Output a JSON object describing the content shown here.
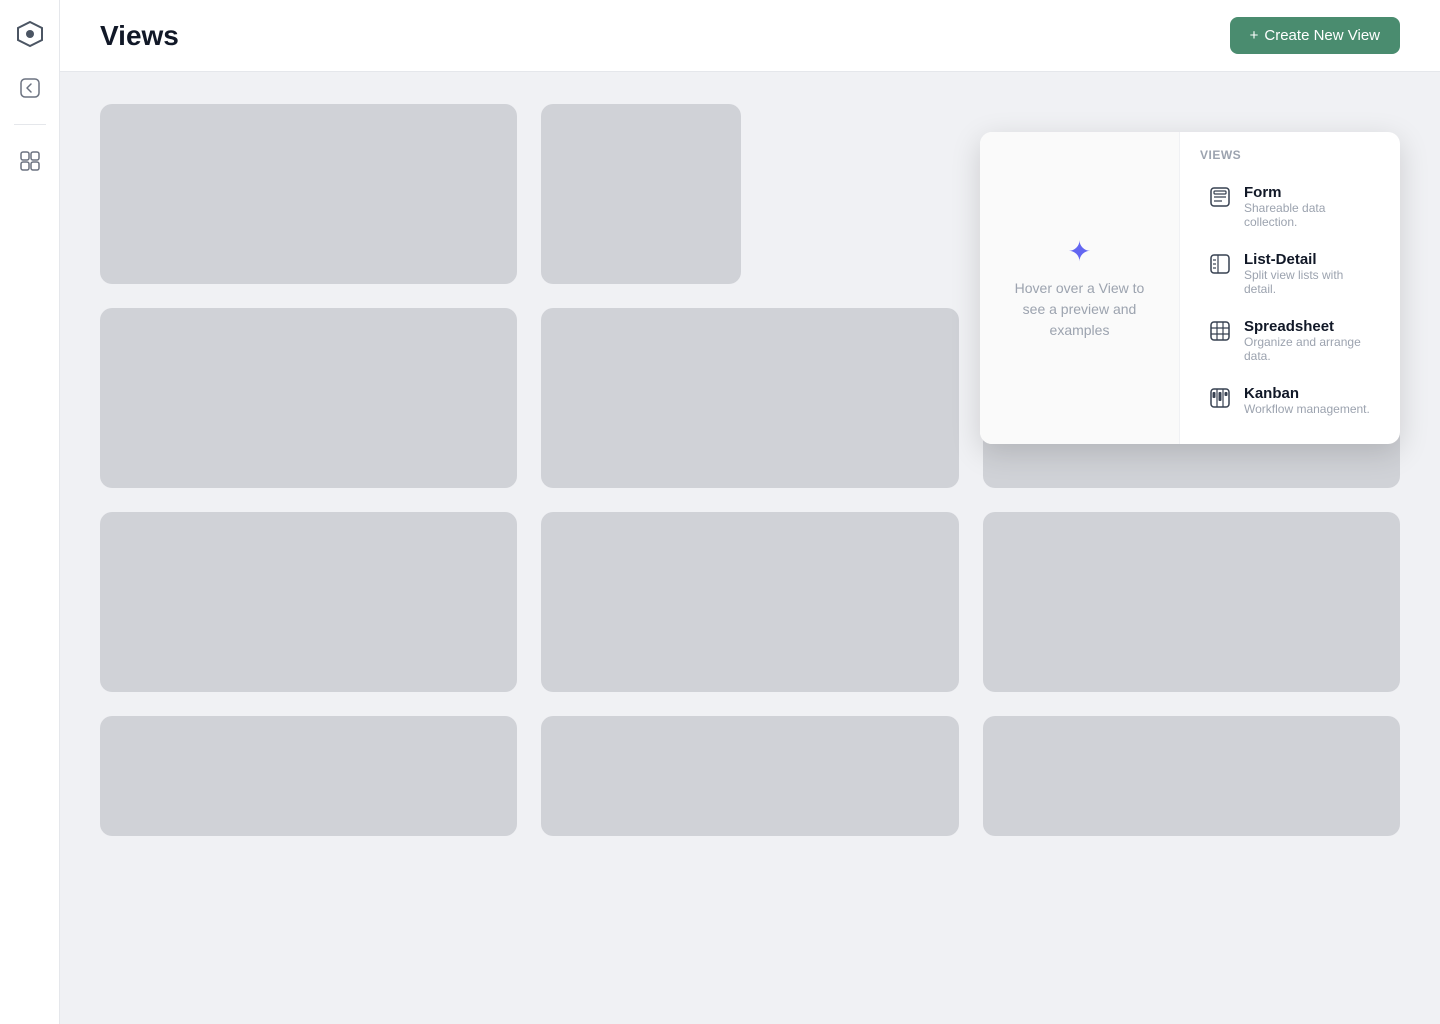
{
  "sidebar": {
    "logo_label": "App Logo",
    "icons": [
      {
        "name": "back-icon",
        "label": "Back"
      },
      {
        "name": "divider"
      },
      {
        "name": "layout-icon",
        "label": "Layout"
      }
    ]
  },
  "header": {
    "title": "Views",
    "create_button_label": "Create New View",
    "create_button_prefix": "+"
  },
  "dropdown": {
    "left": {
      "icon": "✦",
      "text": "Hover over a View to see a preview and examples"
    },
    "section_title": "Views",
    "options": [
      {
        "name": "form",
        "label": "Form",
        "description": "Shareable data collection."
      },
      {
        "name": "list-detail",
        "label": "List-Detail",
        "description": "Split view lists with detail."
      },
      {
        "name": "spreadsheet",
        "label": "Spreadsheet",
        "description": "Organize and arrange data."
      },
      {
        "name": "kanban",
        "label": "Kanban",
        "description": "Workflow management."
      }
    ]
  },
  "grid": {
    "card_count": 11,
    "card_color": "#d0d2d7"
  }
}
